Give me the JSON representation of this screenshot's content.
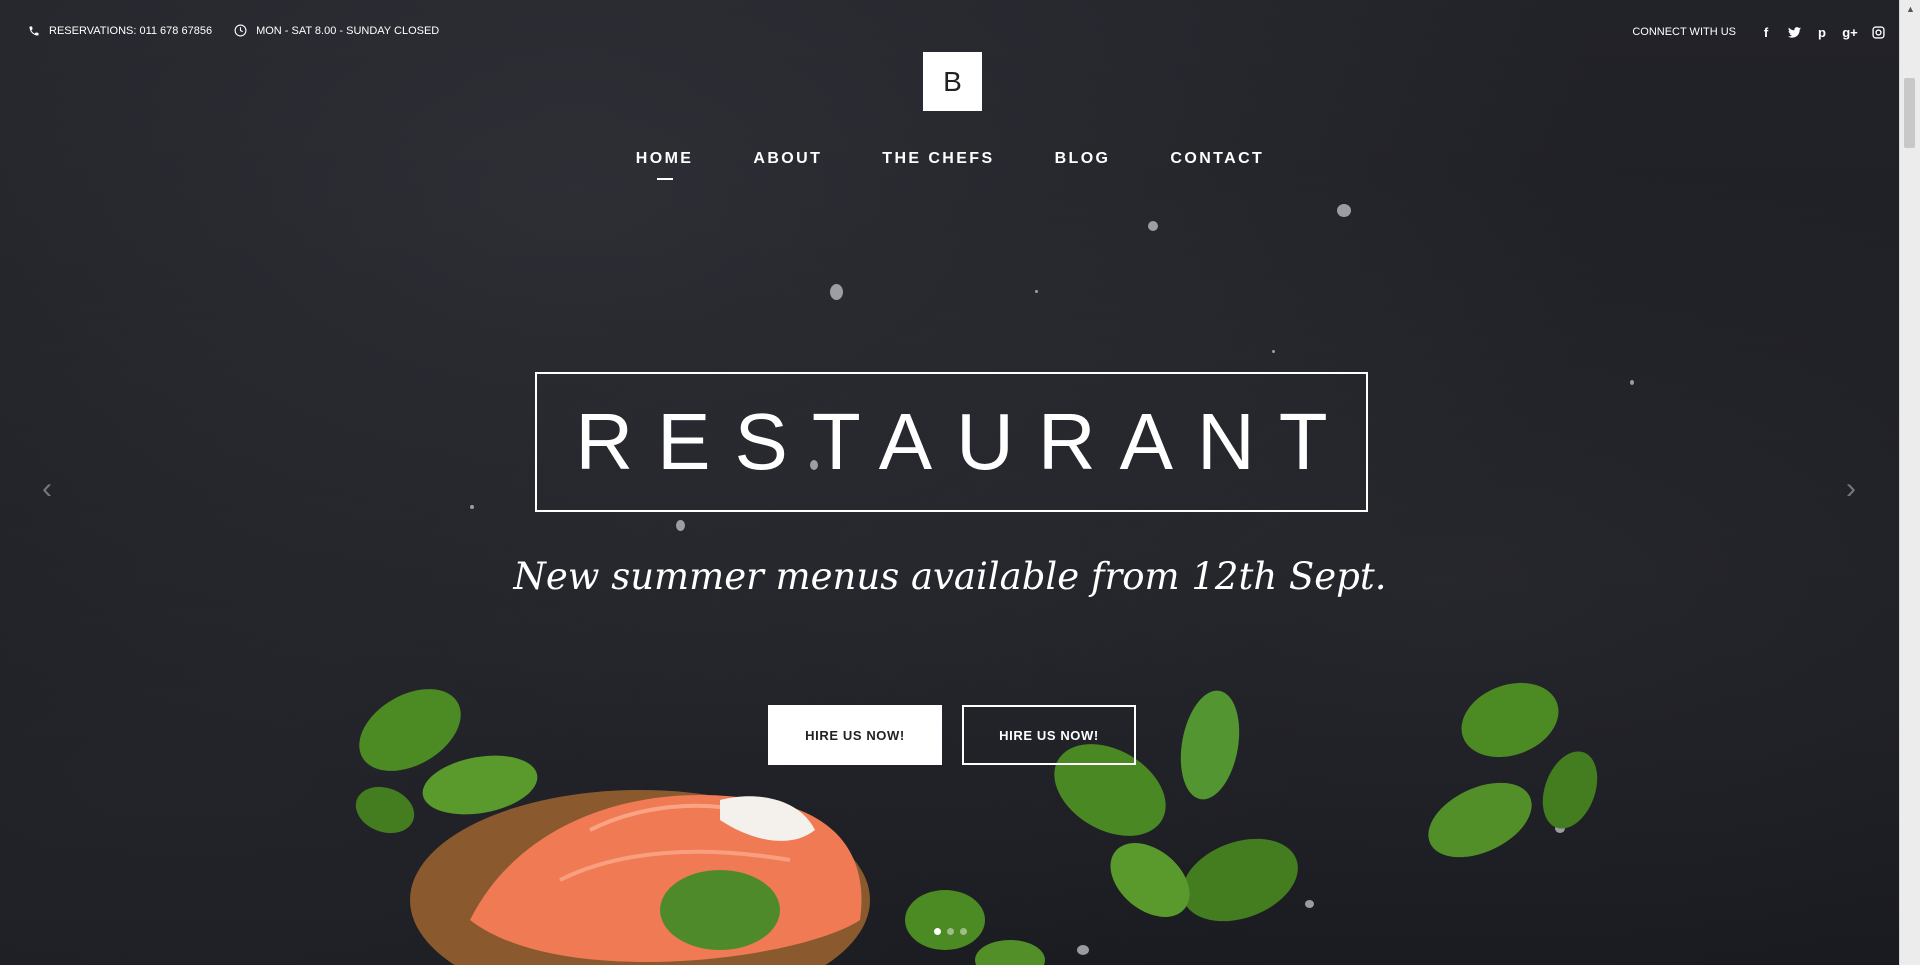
{
  "topbar": {
    "reservations": "RESERVATIONS: 011 678 67856",
    "hours": "MON - SAT 8.00 - SUNDAY CLOSED",
    "connect": "CONNECT WITH US",
    "social": [
      "f",
      "t",
      "p",
      "g+",
      "ig"
    ]
  },
  "logo": {
    "letter": "B"
  },
  "nav": {
    "items": [
      "HOME",
      "ABOUT",
      "THE CHEFS",
      "BLOG",
      "CONTACT"
    ],
    "active": "HOME"
  },
  "hero": {
    "title": "RESTAURANT",
    "subtitle": "New summer menus available from 12th Sept.",
    "button_primary": "HIRE US NOW!",
    "button_secondary": "HIRE US NOW!"
  },
  "slider": {
    "prev_icon": "chevron-left-icon",
    "next_icon": "chevron-right-icon",
    "dots": 3,
    "active_dot": 1
  },
  "colors": {
    "background": "#1d1e23",
    "text": "#ffffff",
    "basil": "#3f7a1e",
    "salmon": "#f07a54"
  }
}
